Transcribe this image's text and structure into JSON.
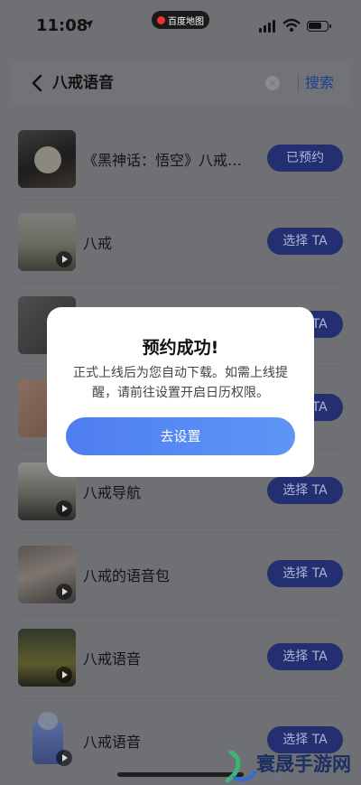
{
  "status_bar": {
    "time": "11:08",
    "map_pill_label": "百度地图"
  },
  "search": {
    "query": "八戒语音",
    "search_label": "搜索"
  },
  "results": [
    {
      "title": "《黑神话：悟空》八戒…",
      "action": "已预约"
    },
    {
      "title": "八戒",
      "action": "选择 TA"
    },
    {
      "title": "",
      "action": "选择 TA"
    },
    {
      "title": "",
      "action": "选择 TA"
    },
    {
      "title": "八戒导航",
      "action": "选择 TA"
    },
    {
      "title": "八戒的语音包",
      "action": "选择 TA"
    },
    {
      "title": "八戒语音",
      "action": "选择 TA"
    },
    {
      "title": "八戒语音",
      "action": "选择 TA"
    }
  ],
  "modal": {
    "title": "预约成功!",
    "body": "正式上线后为您自动下载。如需上线提醒，请前往设置开启日历权限。",
    "button": "去设置"
  },
  "watermark": {
    "text": "寰晟手游网",
    "url": "huan-sun.com"
  },
  "colors": {
    "accent_button": "#232f70",
    "modal_button": "#5b8ef5",
    "search_link": "#1e3f8e"
  }
}
